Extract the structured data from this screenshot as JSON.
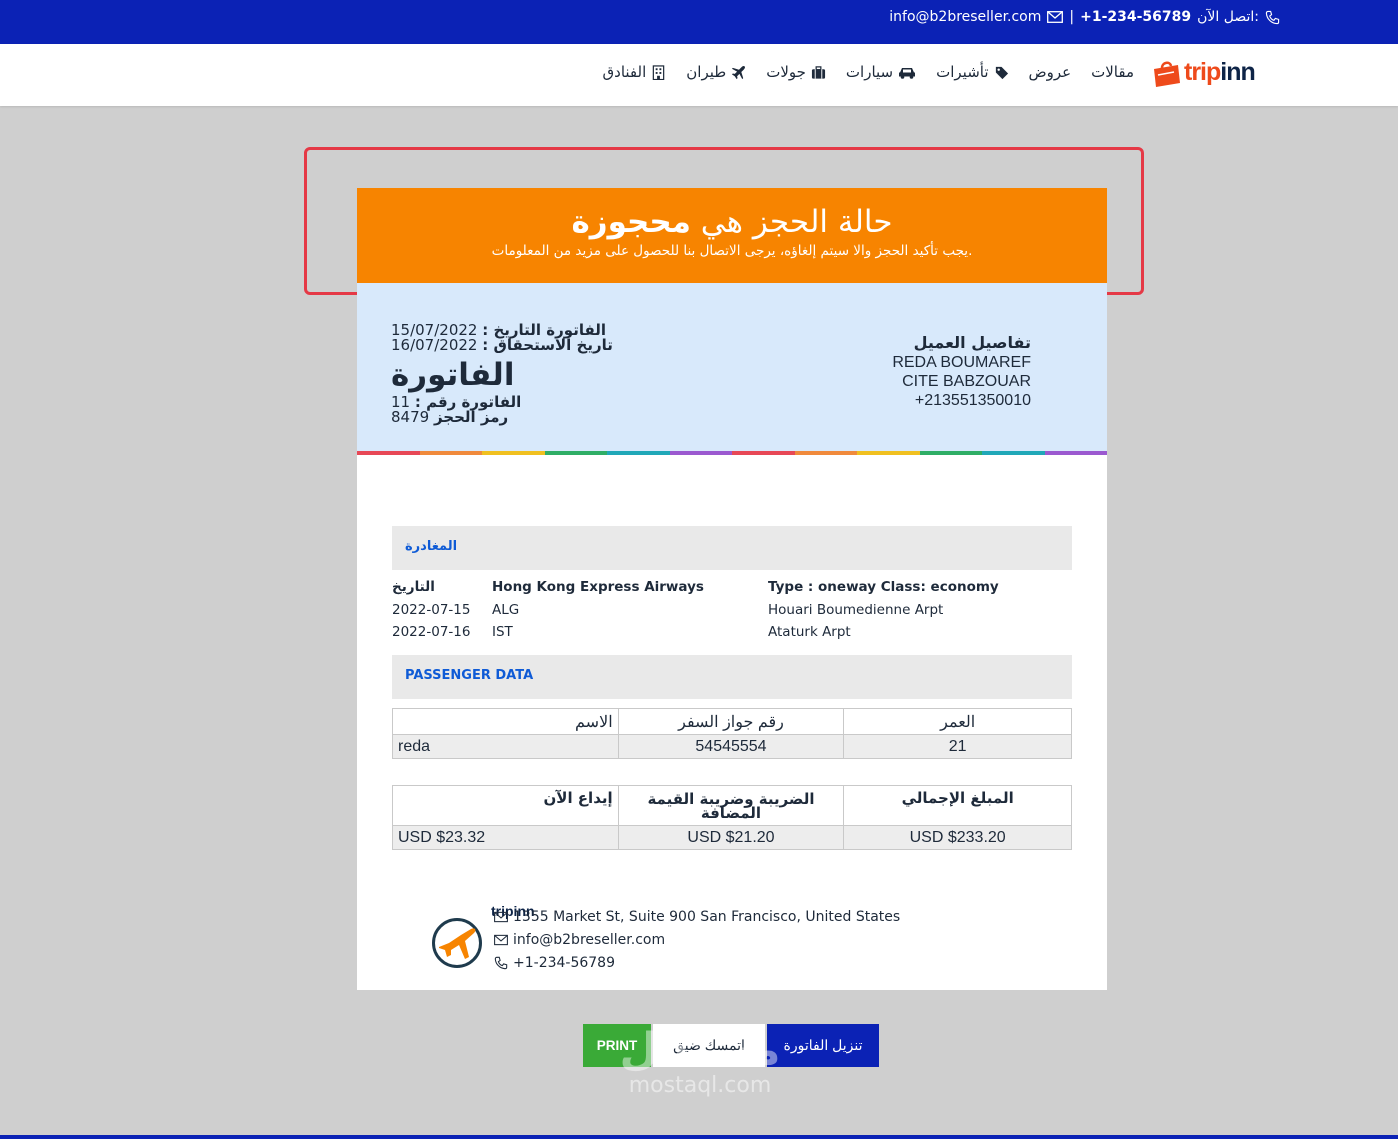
{
  "topbar": {
    "call_label": "اتصل الآن:",
    "phone": "+1-234-56789",
    "separator": "|",
    "email": "info@b2breseller.com"
  },
  "brand": {
    "part1": "trip",
    "part2": "inn"
  },
  "nav": {
    "items": [
      {
        "label": "مقالات",
        "icon": "none"
      },
      {
        "label": "عروض",
        "icon": "none"
      },
      {
        "label": "تأشيرات",
        "icon": "tag-icon"
      },
      {
        "label": "سيارات",
        "icon": "car-icon"
      },
      {
        "label": "جولات",
        "icon": "suitcase-icon"
      },
      {
        "label": "طيران",
        "icon": "plane-icon"
      },
      {
        "label": "الفنادق",
        "icon": "building-icon"
      }
    ]
  },
  "status": {
    "title_prefix": "حالة الحجز هي",
    "title_value": "محجوزة",
    "subtitle": ".يجب تأكيد الحجز والا سيتم إلغاؤه، يرجى الاتصال بنا للحصول على مزيد من المعلومات",
    "color": "#f78400"
  },
  "invoice": {
    "date_label": "الفاتورة التاريخ :",
    "date_value": "15/07/2022",
    "due_label": "تاريخ الاستحقاق :",
    "due_value": "16/07/2022",
    "heading": "الفاتورة",
    "number_label": "الفاتورة رقم :",
    "number_value": "11",
    "booking_label": "رمز الحجز",
    "booking_value": "8479"
  },
  "customer": {
    "title": "تفاصيل العميل",
    "name": "REDA BOUMAREF",
    "address": "CITE BABZOUAR",
    "phone": "+213551350010"
  },
  "departure": {
    "section_title": "المغادرة",
    "date_header": "التاريخ",
    "airline": "Hong Kong Express Airways",
    "type_class": "Type : oneway Class: economy",
    "rows": [
      {
        "date": "2022-07-15",
        "code": "ALG",
        "airport": "Houari Boumedienne Arpt"
      },
      {
        "date": "2022-07-16",
        "code": "IST",
        "airport": "Ataturk Arpt"
      }
    ]
  },
  "passengers": {
    "section_title": "PASSENGER DATA",
    "headers": [
      "الاسم",
      "رقم جواز السفر",
      "العمر"
    ],
    "rows": [
      [
        "reda",
        "54545554",
        "21"
      ]
    ]
  },
  "totals": {
    "headers": [
      "إيداع الآن",
      "الضريبة وضريبة القيمة المضافة",
      "المبلغ الإجمالي"
    ],
    "values": [
      "USD $23.32",
      "USD $21.20",
      "USD $233.20"
    ]
  },
  "company": {
    "name": "tripinn",
    "address": "1355 Market St, Suite 900 San Francisco, United States",
    "email": "info@b2breseller.com",
    "phone": "+1-234-56789"
  },
  "buttons": {
    "print": "PRINT",
    "hold": "اتمسك ضيق",
    "download": "تنزيل الفاتورة"
  },
  "watermark": {
    "arabic": "مستقل",
    "latin": "mostaql.com"
  },
  "colors": {
    "primary": "#0b22b5",
    "orange": "#f78400",
    "green": "#3aaa37",
    "link": "#0f5bd6"
  }
}
